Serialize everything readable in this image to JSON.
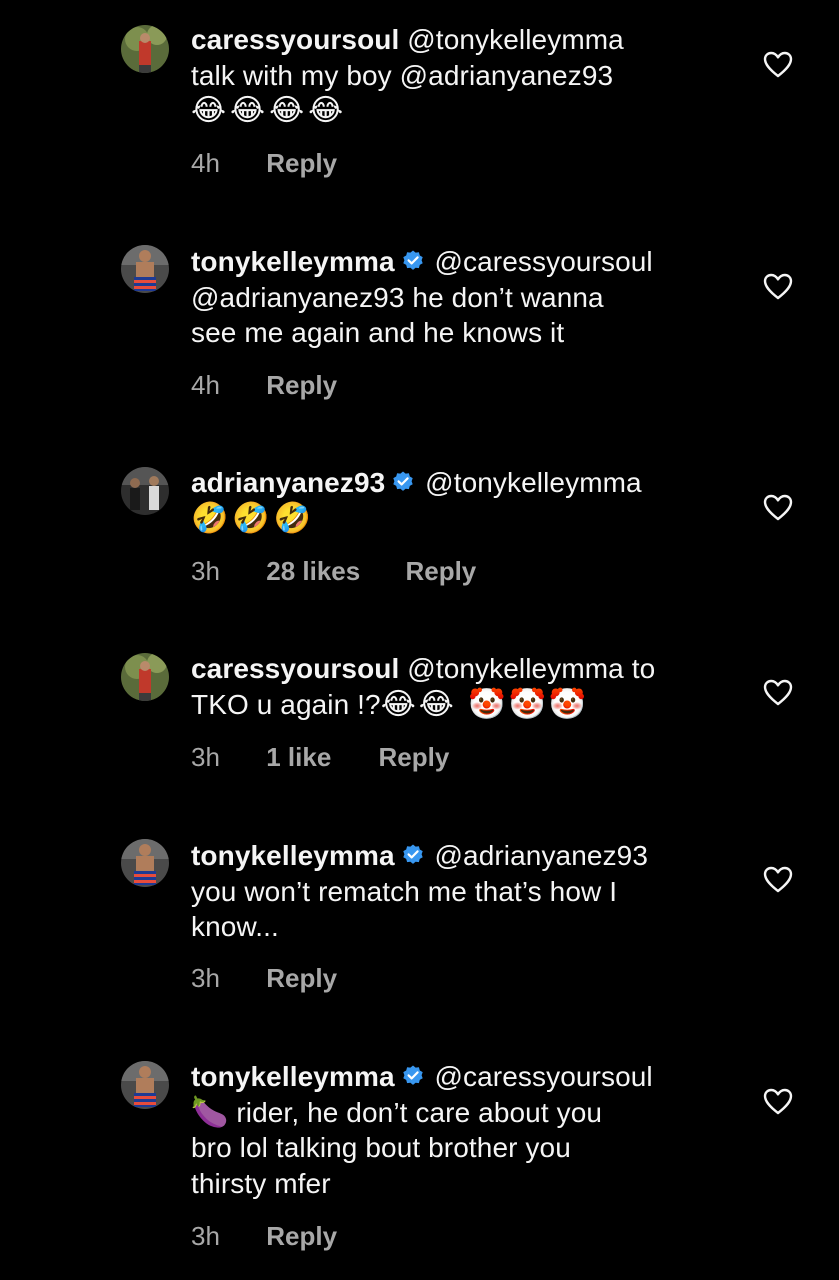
{
  "comments": [
    {
      "username": "caressyoursoul",
      "verified": false,
      "text_line1_rest": " @tonykelleymma",
      "text_line2": "talk with my boy @adrianyanez93",
      "emojis": "😂😂😂😂",
      "time": "4h",
      "likes": "",
      "reply": "Reply"
    },
    {
      "username": "tonykelleymma",
      "verified": true,
      "text_line1_rest": " @caressyoursoul",
      "text_line2": "@adrianyanez93 he don’t wanna",
      "text_line3": "see me again and he knows it",
      "time": "4h",
      "likes": "",
      "reply": "Reply"
    },
    {
      "username": "adrianyanez93",
      "verified": true,
      "text_line1_rest": " @tonykelleymma",
      "emojis": "🤣🤣🤣",
      "time": "3h",
      "likes": "28 likes",
      "reply": "Reply"
    },
    {
      "username": "caressyoursoul",
      "verified": false,
      "text_line1_rest": " @tonykelleymma to",
      "text_line2": "TKO u again !?",
      "emojis": "😂😂 🤡🤡🤡",
      "time": "3h",
      "likes": "1 like",
      "reply": "Reply"
    },
    {
      "username": "tonykelleymma",
      "verified": true,
      "text_line1_rest": " @adrianyanez93",
      "text_line2": "you won’t rematch me that’s how I",
      "text_line3": "know...",
      "time": "3h",
      "likes": "",
      "reply": "Reply"
    },
    {
      "username": "tonykelleymma",
      "verified": true,
      "text_line1_rest": " @caressyoursoul",
      "text_line2_emoji": "🍆",
      "text_line2": " rider, he don’t care about you",
      "text_line3": "bro lol talking bout brother you",
      "text_line4": "thirsty mfer",
      "time": "3h",
      "likes": "",
      "reply": "Reply"
    }
  ],
  "colors": {
    "background": "#000000",
    "text": "#f5f5f5",
    "secondary": "#a8a8a8",
    "verified": "#3897f0"
  },
  "icons": {
    "like": "heart-outline-icon",
    "verified": "verified-badge-icon"
  }
}
